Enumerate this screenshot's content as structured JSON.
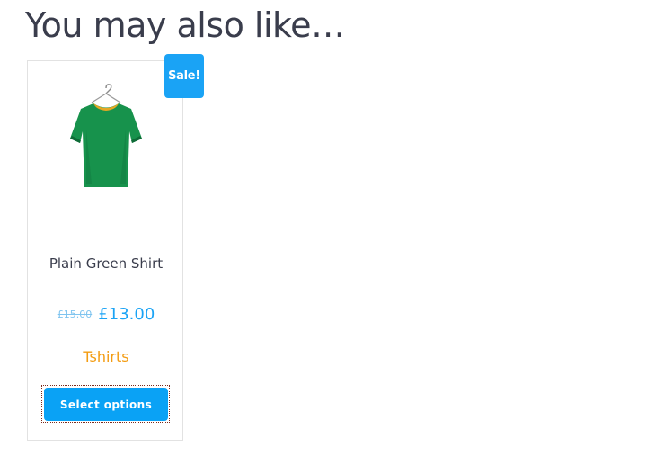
{
  "section": {
    "title": "You may also like…"
  },
  "product": {
    "badge": "Sale!",
    "name": "Plain Green Shirt",
    "price_old": "£15.00",
    "price_new": "£13.00",
    "category": "Tshirts",
    "button_label": "Select options",
    "image_icon": "green-tshirt-on-hanger"
  },
  "colors": {
    "accent": "#1aa3f5",
    "category": "#f39c12",
    "shirt": "#17924c",
    "collar": "#e6a823"
  }
}
